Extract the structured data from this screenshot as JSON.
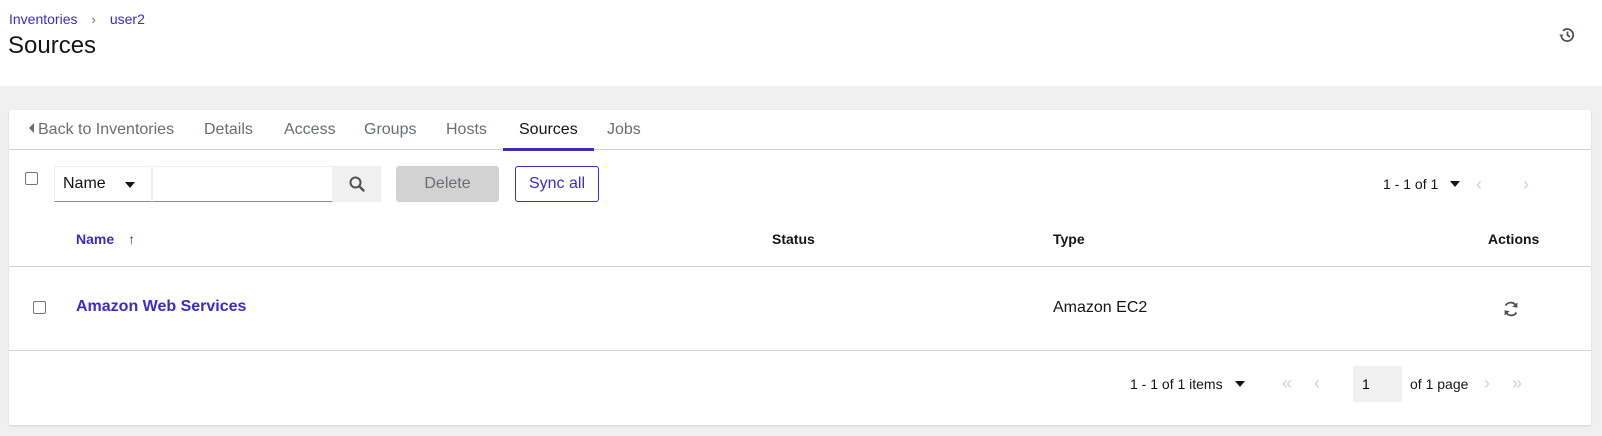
{
  "breadcrumb": {
    "root": "Inventories",
    "separator": "›",
    "current": "user2"
  },
  "page_title": "Sources",
  "header": {
    "history_icon": "history-icon"
  },
  "tabs": [
    {
      "label": "Back to Inventories"
    },
    {
      "label": "Details"
    },
    {
      "label": "Access"
    },
    {
      "label": "Groups"
    },
    {
      "label": "Hosts"
    },
    {
      "label": "Sources",
      "active": true
    },
    {
      "label": "Jobs"
    }
  ],
  "toolbar": {
    "filter_field": "Name",
    "search_value": "",
    "delete_label": "Delete",
    "sync_all_label": "Sync all",
    "pagination": "1 - 1 of 1"
  },
  "table": {
    "columns": {
      "name": "Name",
      "status": "Status",
      "type": "Type",
      "actions": "Actions"
    },
    "sort_indicator": "↑",
    "rows": [
      {
        "name": "Amazon Web Services",
        "status": "",
        "type": "Amazon EC2",
        "action_icon": "sync-icon"
      }
    ]
  },
  "footer_pagination": {
    "count": "1 - 1 of 1 items",
    "page": "1",
    "of_pages": "of 1 page"
  },
  "colors": {
    "accent": "#3b2bc8",
    "background": "#f0f0f0",
    "border": "#d2d2d2"
  }
}
